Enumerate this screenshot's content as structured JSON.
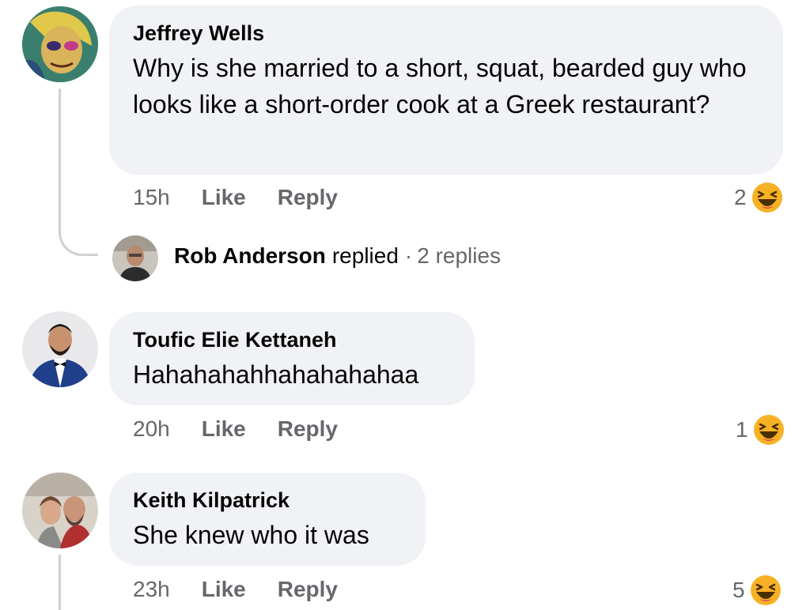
{
  "comments": [
    {
      "author": "Jeffrey Wells",
      "text": "Why is she married to a short, squat, bearded guy who looks like a short-order cook at a Greek restaurant?",
      "time": "15h",
      "like_label": "Like",
      "reply_label": "Reply",
      "reaction_count": "2",
      "reaction_icon": "haha-emoji-icon",
      "replies_preview": {
        "author": "Rob Anderson",
        "action": "replied",
        "separator": "·",
        "count": "2 replies"
      }
    },
    {
      "author": "Toufic Elie Kettaneh",
      "text": "Hahahahahhahahahahaa",
      "time": "20h",
      "like_label": "Like",
      "reply_label": "Reply",
      "reaction_count": "1",
      "reaction_icon": "haha-emoji-icon"
    },
    {
      "author": "Keith Kilpatrick",
      "text": "She knew who it was",
      "time": "23h",
      "like_label": "Like",
      "reply_label": "Reply",
      "reaction_count": "5",
      "reaction_icon": "haha-emoji-icon"
    }
  ],
  "colors": {
    "bubble": "#f0f2f5",
    "meta_text": "#65676b",
    "thread_line": "#ced0d4",
    "haha_yellow": "#f7b125"
  }
}
